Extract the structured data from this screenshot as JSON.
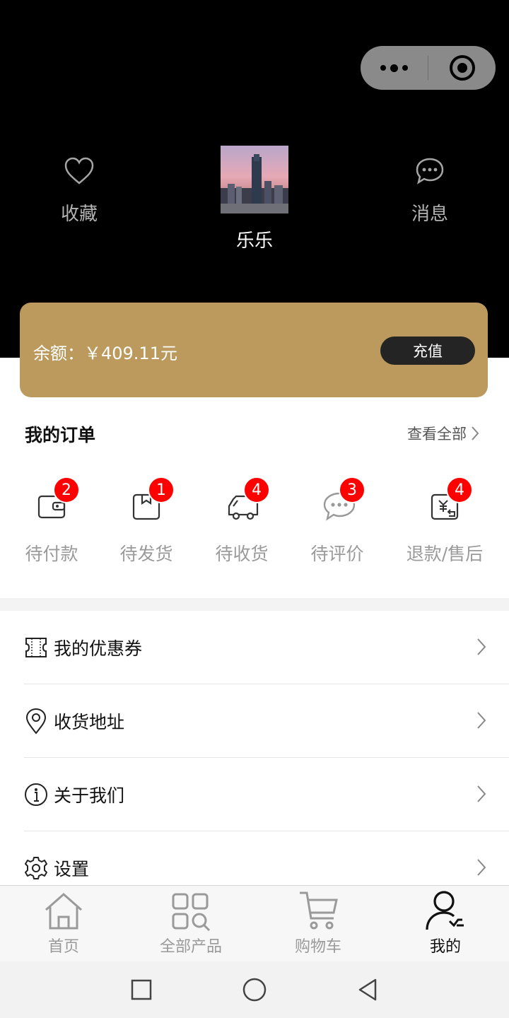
{
  "header": {
    "favorites_label": "收藏",
    "messages_label": "消息",
    "username": "乐乐"
  },
  "balance": {
    "text": "余额：￥409.11元",
    "recharge_label": "充值"
  },
  "orders": {
    "title": "我的订单",
    "view_all": "查看全部",
    "items": [
      {
        "label": "待付款",
        "badge": "2",
        "icon": "wallet-icon"
      },
      {
        "label": "待发货",
        "badge": "1",
        "icon": "package-icon"
      },
      {
        "label": "待收货",
        "badge": "4",
        "icon": "truck-icon"
      },
      {
        "label": "待评价",
        "badge": "3",
        "icon": "comment-icon"
      },
      {
        "label": "退款/售后",
        "badge": "4",
        "icon": "refund-icon"
      }
    ]
  },
  "menu": [
    {
      "label": "我的优惠券",
      "icon": "coupon-icon"
    },
    {
      "label": "收货地址",
      "icon": "location-icon"
    },
    {
      "label": "关于我们",
      "icon": "info-icon"
    },
    {
      "label": "设置",
      "icon": "gear-icon"
    }
  ],
  "tabs": [
    {
      "label": "首页",
      "icon": "home-icon"
    },
    {
      "label": "全部产品",
      "icon": "grid-search-icon"
    },
    {
      "label": "购物车",
      "icon": "cart-icon"
    },
    {
      "label": "我的",
      "icon": "user-icon",
      "active": true
    }
  ],
  "colors": {
    "accent_gold": "#bc9a5d",
    "badge_red": "#ff0000",
    "header_bg": "#000000"
  }
}
